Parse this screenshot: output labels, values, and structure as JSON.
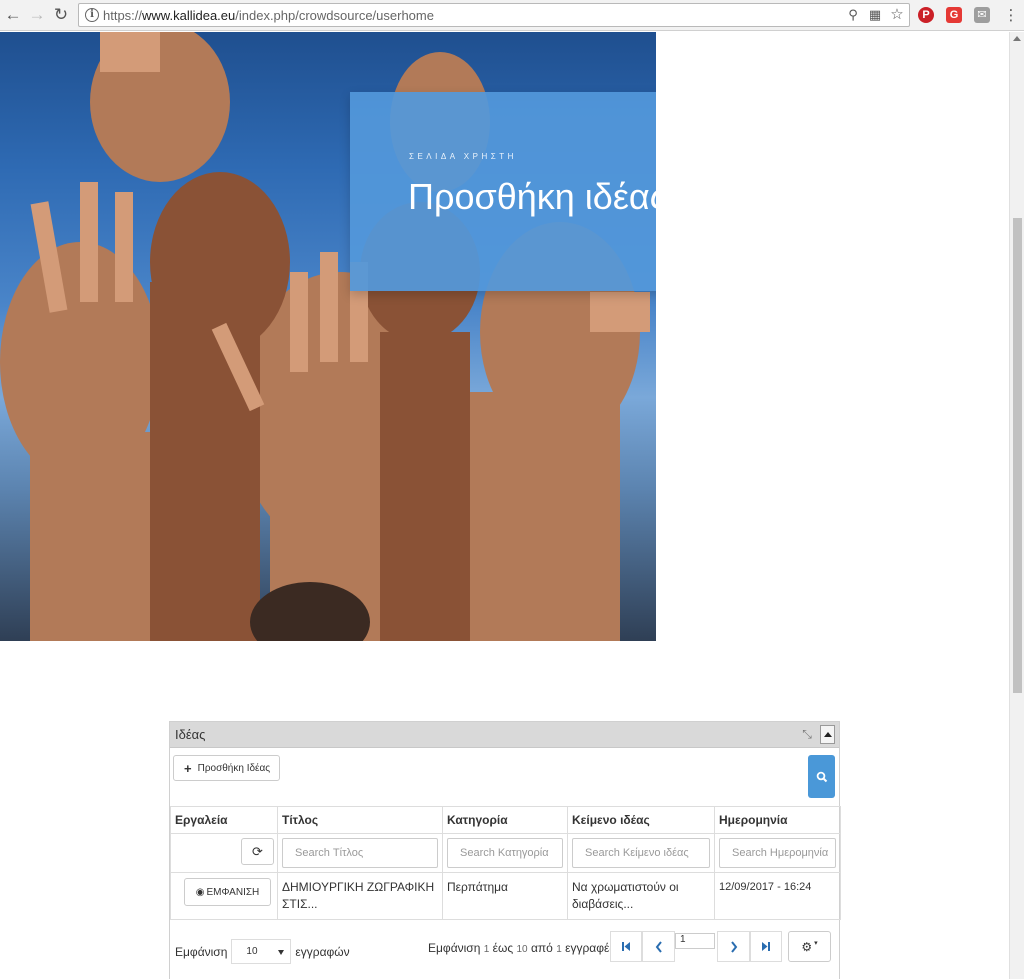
{
  "browser": {
    "url_prefix": "https://",
    "url_domain": "www.kallidea.eu",
    "url_path": "/index.php/crowdsource/userhome"
  },
  "hero": {
    "subtitle": "ΣΕΛΙΔΑ ΧΡΗΣΤΗ",
    "title": "Προσθήκη ιδέας",
    "box_color": "#5398da"
  },
  "panel": {
    "title": "Ιδέας",
    "add_button": "Προσθήκη Ιδέας",
    "columns": [
      "Εργαλεία",
      "Τίτλος",
      "Κατηγορία",
      "Κείμενο ιδέας",
      "Ημερομηνία"
    ],
    "filters": [
      "Search Τίτλος",
      "Search Κατηγορία",
      "Search Κείμενο ιδέας",
      "Search Ημερομηνία"
    ],
    "rows": [
      {
        "action": "ΕΜΦΑΝΙΣΗ",
        "title": "ΔΗΜΙΟΥΡΓΙΚΗ ΖΩΓΡΑΦΙΚΗ ΣΤΙΣ...",
        "category": "Περπάτημα",
        "text": "Να χρωματιστούν οι διαβάσεις...",
        "date": "12/09/2017 - 16:24"
      }
    ],
    "footer": {
      "show_label": "Εμφάνιση",
      "page_length": "10",
      "records_label": "εγγραφών",
      "info_show": "Εμφάνιση",
      "info_from": "1",
      "info_to_word": "έως",
      "info_to": "10",
      "info_of_word": "από",
      "info_total": "1",
      "info_records": "εγγραφές",
      "current_page": "1"
    },
    "accent_color": "#4a98d8"
  }
}
